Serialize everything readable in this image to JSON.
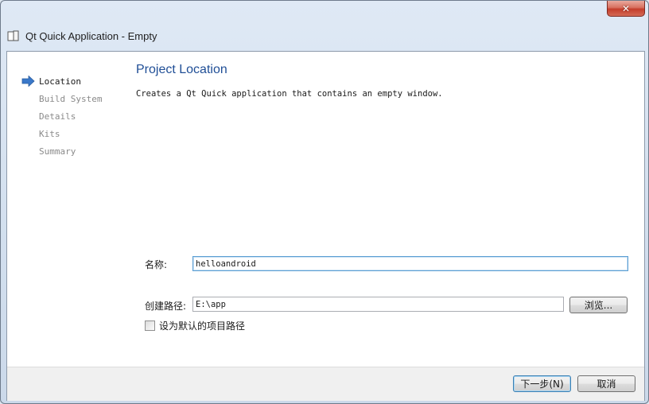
{
  "window": {
    "title": "Qt Quick Application - Empty",
    "close_glyph": "✕"
  },
  "wizard_steps": [
    {
      "label": "Location",
      "active": true
    },
    {
      "label": "Build System",
      "active": false
    },
    {
      "label": "Details",
      "active": false
    },
    {
      "label": "Kits",
      "active": false
    },
    {
      "label": "Summary",
      "active": false
    }
  ],
  "page": {
    "title": "Project Location",
    "description": "Creates a Qt Quick application that contains an empty window."
  },
  "form": {
    "name_label": "名称:",
    "name_value": "helloandroid",
    "path_label": "创建路径:",
    "path_value": "E:\\app",
    "browse_label": "浏览...",
    "default_checkbox_label": "设为默认的项目路径",
    "default_checked": false
  },
  "footer": {
    "next_label": "下一步(N)",
    "cancel_label": "取消"
  },
  "colors": {
    "accent": "#1f4e96",
    "arrow": "#3a78c9"
  }
}
